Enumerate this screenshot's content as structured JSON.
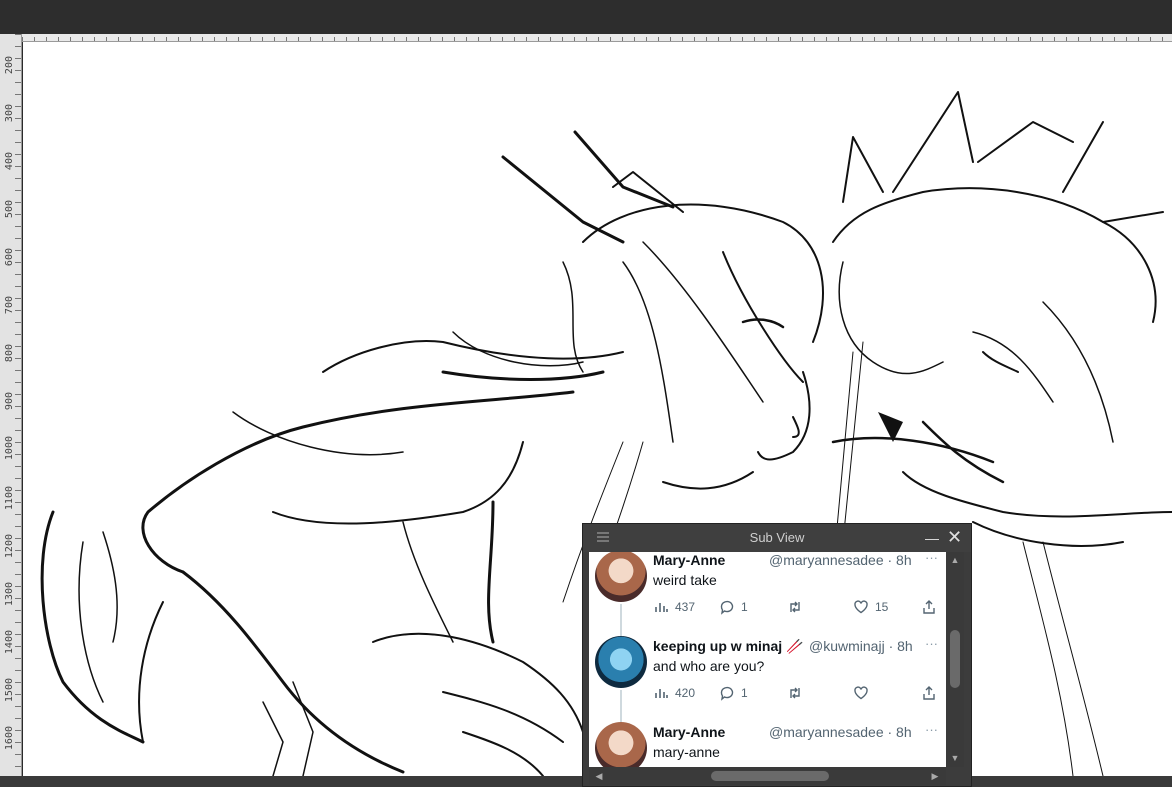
{
  "app": {
    "ruler_labels": [
      "200",
      "300",
      "400",
      "500",
      "600",
      "700",
      "800",
      "900",
      "1000",
      "1100",
      "1200",
      "1300",
      "1400",
      "1500",
      "1600"
    ]
  },
  "subview": {
    "title": "Sub View",
    "minimize_glyph": "—",
    "close_glyph": "✕"
  },
  "tweets": [
    {
      "name": "Mary-Anne",
      "handle": "@maryannesadee · 8h",
      "text": "weird take",
      "views": "437",
      "replies": "1",
      "likes": "15",
      "avatar": "anime-girl-brown-hair"
    },
    {
      "name": "keeping up w minaj 🥢",
      "handle": "@kuwminajj · 8h",
      "text": "and who are you?",
      "views": "420",
      "replies": "1",
      "likes": "",
      "avatar": "blue-character"
    },
    {
      "name": "Mary-Anne",
      "handle": "@maryannesadee · 8h",
      "text": "mary-anne",
      "views": "",
      "replies": "",
      "likes": "",
      "avatar": "anime-girl-brown-hair"
    }
  ],
  "icons": {
    "more": "···",
    "views": "bar-chart-icon",
    "reply": "speech-bubble-icon",
    "retweet": "retweet-icon",
    "like": "heart-icon",
    "share": "share-icon"
  },
  "colors": {
    "app_bg": "#2b2b2b",
    "canvas": "#ffffff",
    "handle_gray": "#536471"
  }
}
